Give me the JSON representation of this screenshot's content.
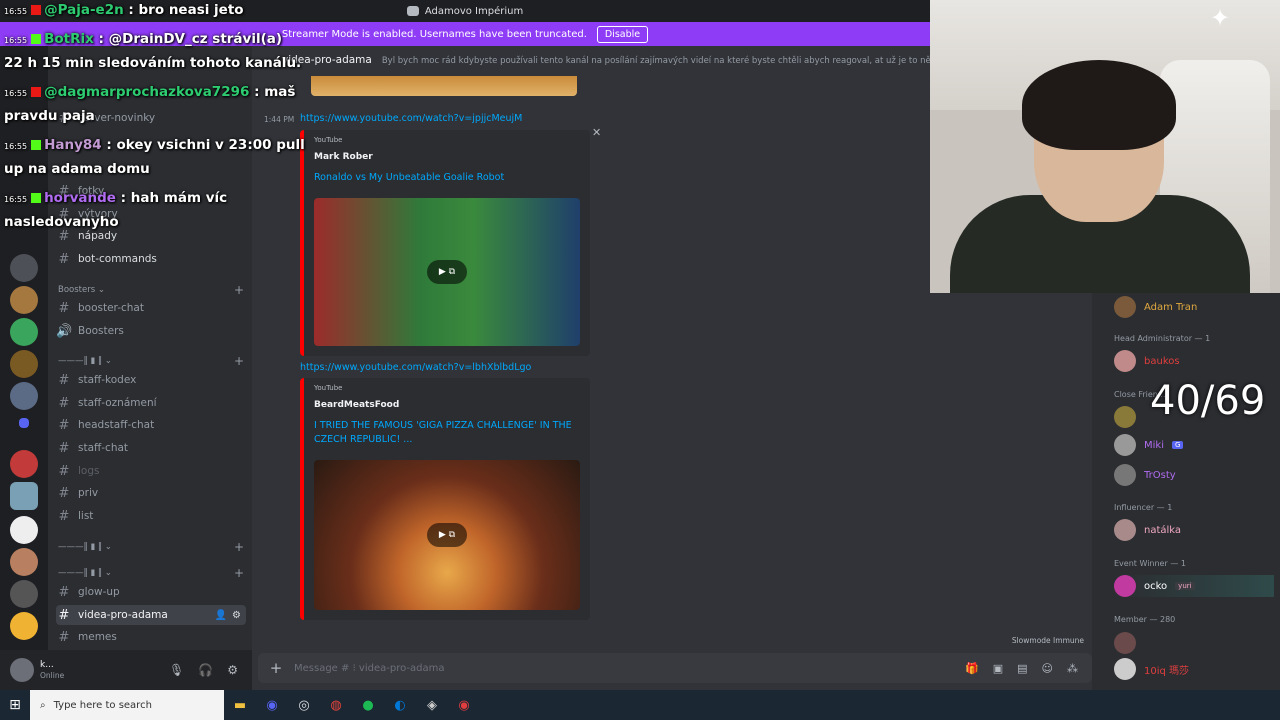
{
  "titlebar": {
    "server_name": "Adamovo Impérium"
  },
  "banner": {
    "text": "Streamer Mode is enabled. Usernames have been truncated.",
    "disable": "Disable"
  },
  "channel_header": {
    "name": "videa-pro-adama",
    "topic": "Byl bych moc rád kdybyste používali tento kanál na posílání zajímavých videí na které byste chtěli abych reagoval, at už je to nějaké dran"
  },
  "sidebar": {
    "channels": [
      {
        "label": "server-novinky",
        "dim": false
      },
      {
        "label": "fotky",
        "dim": false
      },
      {
        "label": "výtvory",
        "dim": false
      },
      {
        "label": "nápady",
        "dim": false
      },
      {
        "label": "bot-commands",
        "dim": false
      }
    ],
    "boosters_category": "Boosters",
    "boosters": [
      {
        "label": "booster-chat"
      },
      {
        "label": "Boosters"
      }
    ],
    "staff": [
      {
        "label": "staff-kodex",
        "dim": false
      },
      {
        "label": "staff-oznámení",
        "dim": false
      },
      {
        "label": "headstaff-chat",
        "dim": false
      },
      {
        "label": "staff-chat",
        "dim": false
      },
      {
        "label": "logs",
        "dim": true
      },
      {
        "label": "priv",
        "dim": false
      },
      {
        "label": "list",
        "dim": false
      }
    ],
    "bottom": [
      {
        "label": "glow-up"
      },
      {
        "label": "videa-pro-adama",
        "active": true
      },
      {
        "label": "memes"
      }
    ]
  },
  "user": {
    "name": "k...",
    "status": "Online"
  },
  "messages": [
    {
      "time": "1:44 PM",
      "link": "https://www.youtube.com/watch?v=jpjjcMeujM",
      "provider": "YouTube",
      "author": "Mark Rober",
      "title": "Ronaldo vs My Unbeatable Goalie Robot"
    },
    {
      "time": "",
      "link": "https://www.youtube.com/watch?v=lbhXblbdLgo",
      "provider": "YouTube",
      "author": "BeardMeatsFood",
      "title": "I TRIED THE FAMOUS 'GIGA PIZZA CHALLENGE' IN THE CZECH REPUBLIC! ..."
    }
  ],
  "slowmode": "Slowmode Immune",
  "composer": {
    "placeholder": "Message # ⁝ videa-pro-adama"
  },
  "members": {
    "groups": [
      {
        "label": "Head Administrator — 1",
        "members": [
          "baukos"
        ]
      },
      {
        "label": "Close Frien...",
        "members": [
          "",
          "Miki",
          "TrOsty"
        ]
      },
      {
        "label": "Influencer — 1",
        "members": [
          "natálka"
        ]
      },
      {
        "label": "Event Winner — 1",
        "members": [
          "ocko"
        ]
      },
      {
        "label": "Member — 280",
        "members": [
          "",
          "10iq 瑪莎"
        ]
      }
    ],
    "top_member": "Adam Tran",
    "miki_badge": "G",
    "ocko_tag": "yuri"
  },
  "overlay": {
    "lines": [
      {
        "time": "16:55",
        "user": "@Paja-e2n",
        "user_color": "#2ecc71",
        "text": " : bro neasi jeto"
      },
      {
        "time": "16:55",
        "user": "BotRix",
        "user_color": "#2ecc71",
        "text": " : @DrainDV_cz strávil(a)"
      },
      {
        "time": "",
        "user": "",
        "user_color": "#ffffff",
        "text": "22 h 15 min sledováním tohoto kanálu."
      },
      {
        "time": "16:55",
        "user": "@dagmarprochazkova7296",
        "user_color": "#2ecc71",
        "text": " : maš"
      },
      {
        "time": "",
        "user": "",
        "user_color": "#ffffff",
        "text": "pravdu paja"
      },
      {
        "time": "16:55",
        "user": "Hany84",
        "user_color": "#c39bd3",
        "text": " : okey vsichni v 23:00 pull"
      },
      {
        "time": "",
        "user": "",
        "user_color": "#ffffff",
        "text": "up na adama domu"
      },
      {
        "time": "16:55",
        "user": "horvande",
        "user_color": "#b06cf0",
        "text": " : hah mám víc"
      },
      {
        "time": "",
        "user": "",
        "user_color": "#ffffff",
        "text": "nasledovanyho"
      }
    ],
    "counter": "40/69"
  },
  "taskbar": {
    "search_placeholder": "Type here to search"
  },
  "colors": {
    "accent": "#8f3cf7",
    "link": "#00a8fc",
    "youtube": "#ff0000"
  }
}
